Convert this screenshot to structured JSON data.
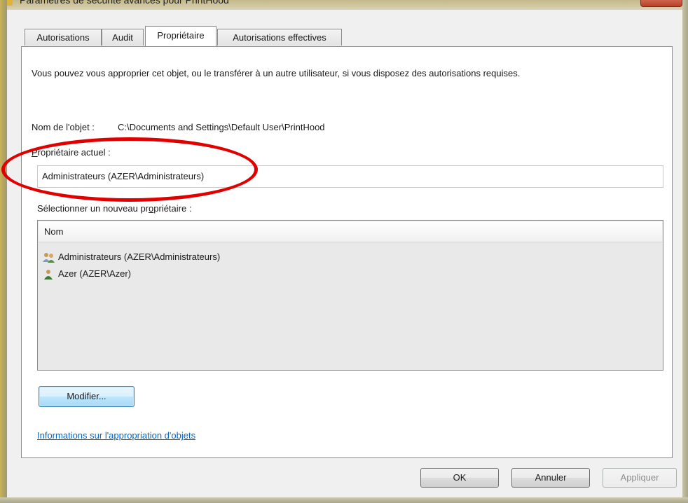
{
  "window": {
    "title": "Paramètres de sécurité avancés pour PrintHood"
  },
  "tabs": [
    {
      "label": "Autorisations",
      "active": false
    },
    {
      "label": "Audit",
      "active": false
    },
    {
      "label": "Propriétaire",
      "active": true
    },
    {
      "label": "Autorisations effectives",
      "active": false
    }
  ],
  "owner_tab": {
    "description": "Vous pouvez vous approprier cet objet, ou le transférer à un autre utilisateur, si vous disposez des autorisations requises.",
    "object_name_label": "Nom de l'objet :",
    "object_name_value": "C:\\Documents and Settings\\Default User\\PrintHood",
    "current_owner_label_first": "P",
    "current_owner_label_rest": "ropriétaire actuel :",
    "current_owner_value": "Administrateurs (AZER\\Administrateurs)",
    "new_owner_label_pre": "Sélectionner un nouveau pr",
    "new_owner_label_ul": "o",
    "new_owner_label_post": "priétaire :",
    "list": {
      "header": "Nom",
      "items": [
        {
          "label": "Administrateurs (AZER\\Administrateurs)",
          "icon": "group-users-icon"
        },
        {
          "label": "Azer (AZER\\Azer)",
          "icon": "user-icon"
        }
      ]
    },
    "modify_button": "Modifier...",
    "info_link": "Informations sur l'appropriation d'objets"
  },
  "footer": {
    "ok": "OK",
    "cancel": "Annuler",
    "apply": "Appliquer"
  },
  "colors": {
    "link": "#0066cc",
    "annotation": "#e00000",
    "focus_button": "#3c7fb1"
  }
}
